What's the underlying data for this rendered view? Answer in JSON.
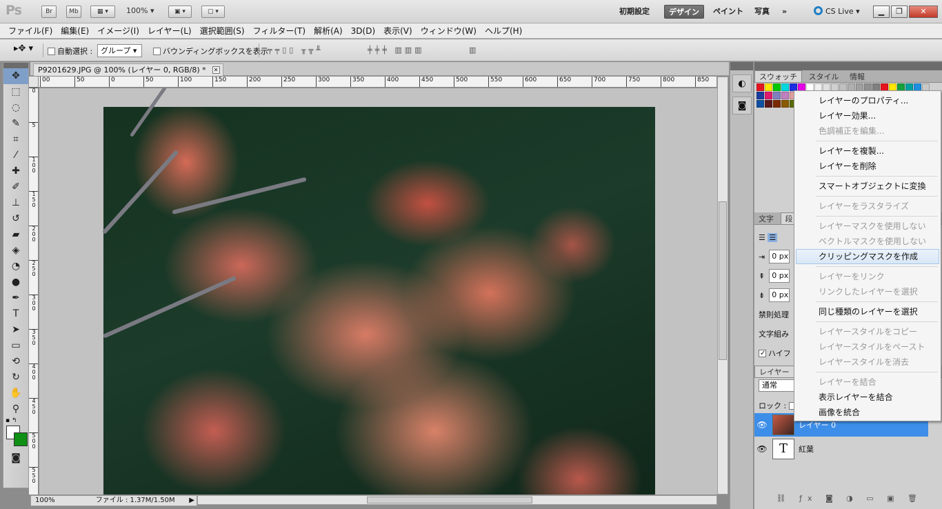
{
  "app": {
    "logo": "Ps",
    "quick_buttons": [
      "Br",
      "Mb"
    ],
    "zoom": "100%",
    "workspaces": [
      "初期設定",
      "デザイン",
      "ペイント",
      "写真"
    ],
    "active_workspace": "デザイン",
    "more": "»",
    "cs_live": "CS Live"
  },
  "menu": [
    "ファイル(F)",
    "編集(E)",
    "イメージ(I)",
    "レイヤー(L)",
    "選択範囲(S)",
    "フィルター(T)",
    "解析(A)",
    "3D(D)",
    "表示(V)",
    "ウィンドウ(W)",
    "ヘルプ(H)"
  ],
  "options": {
    "auto_select_label": "自動選択 :",
    "auto_select_value": "グループ",
    "bbox_label": "バウンディングボックスを表示"
  },
  "document": {
    "tab_title": "P9201629.JPG @ 100% (レイヤー 0, RGB/8) *",
    "hruler_ticks": [
      "00",
      "50",
      "0",
      "50",
      "100",
      "150",
      "200",
      "250",
      "300",
      "350",
      "400",
      "450",
      "500",
      "550",
      "600",
      "650",
      "700",
      "750",
      "800",
      "850"
    ],
    "vruler_ticks": [
      "0",
      "5",
      "1\n0\n0",
      "1\n5\n0",
      "2\n0\n0",
      "2\n5\n0",
      "3\n0\n0",
      "3\n5\n0",
      "4\n0\n0",
      "4\n5\n0",
      "5\n0\n0",
      "5\n5\n0"
    ],
    "zoom_status": "100%",
    "file_status": "ファイル : 1.37M/1.50M"
  },
  "panels": {
    "swatch_tabs": [
      "スウォッチ",
      "スタイル",
      "情報"
    ],
    "swatch_colors": [
      "#e6141e",
      "#ffe600",
      "#00c800",
      "#00d8e0",
      "#1d2fe0",
      "#e600e6",
      "#ffffff",
      "#f0f0f0",
      "#e0e0e0",
      "#d0d0d0",
      "#c0c0c0",
      "#b0b0b0",
      "#a0a0a0",
      "#909090",
      "#808080",
      "#e6141e",
      "#ffe600",
      "#14a03c",
      "#00a0a0",
      "#1d8fe0",
      "#c8c8c8",
      "#1a3c9e",
      "#e01a6e",
      "#8080c0",
      "#c080c0",
      "#e0a0a0",
      "#c0c060",
      "#80c0a0",
      "#60a0c0",
      "#3050b0",
      "#6060a0",
      "#a06080",
      "#c06060",
      "#a0a040",
      "#40a060",
      "#2080a0",
      "#7030a0",
      "#a03080",
      "#d05050",
      "#c07020",
      "#809020",
      "#208060",
      "#1050a0",
      "#5a1a1a",
      "#7a2a00",
      "#8a5a00",
      "#5a6a00",
      "#1a5a2a",
      "#1a4a5a",
      "#1a5a1a",
      "#0a4a2a",
      "#1a4a1a",
      "#0a3a3a",
      "#2a2a5a",
      "#4a1a4a",
      "#6a3a10"
    ],
    "char_tabs": [
      "文字",
      "段"
    ],
    "char_fields": [
      "0 px",
      "0 px",
      "0 px"
    ],
    "char_labels": [
      "禁則処理",
      "文字組み"
    ],
    "hyphen_label": "ハイフ",
    "layers_tab": "レイヤー",
    "blend_mode": "通常",
    "lock_label": "ロック :",
    "layers": [
      {
        "name": "レイヤー 0",
        "selected": true,
        "kind": "image"
      },
      {
        "name": "紅葉",
        "selected": false,
        "kind": "text"
      }
    ]
  },
  "context_menu": {
    "groups": [
      [
        {
          "label": "レイヤーのプロパティ...",
          "enabled": true
        },
        {
          "label": "レイヤー効果...",
          "enabled": true
        },
        {
          "label": "色調補正を編集...",
          "enabled": false
        }
      ],
      [
        {
          "label": "レイヤーを複製...",
          "enabled": true
        },
        {
          "label": "レイヤーを削除",
          "enabled": true
        }
      ],
      [
        {
          "label": "スマートオブジェクトに変換",
          "enabled": true
        }
      ],
      [
        {
          "label": "レイヤーをラスタライズ",
          "enabled": false
        }
      ],
      [
        {
          "label": "レイヤーマスクを使用しない",
          "enabled": false
        },
        {
          "label": "ベクトルマスクを使用しない",
          "enabled": false
        },
        {
          "label": "クリッピングマスクを作成",
          "enabled": true,
          "hover": true
        }
      ],
      [
        {
          "label": "レイヤーをリンク",
          "enabled": false
        },
        {
          "label": "リンクしたレイヤーを選択",
          "enabled": false
        }
      ],
      [
        {
          "label": "同じ種類のレイヤーを選択",
          "enabled": true
        }
      ],
      [
        {
          "label": "レイヤースタイルをコピー",
          "enabled": false
        },
        {
          "label": "レイヤースタイルをペースト",
          "enabled": false
        },
        {
          "label": "レイヤースタイルを消去",
          "enabled": false
        }
      ],
      [
        {
          "label": "レイヤーを結合",
          "enabled": false
        },
        {
          "label": "表示レイヤーを結合",
          "enabled": true
        },
        {
          "label": "画像を統合",
          "enabled": true
        }
      ]
    ]
  },
  "colors": {
    "foreground": "#ffffff",
    "background": "#108f15",
    "selection": "#3d8ee8",
    "menu_hover_border": "#a8c6ea"
  }
}
